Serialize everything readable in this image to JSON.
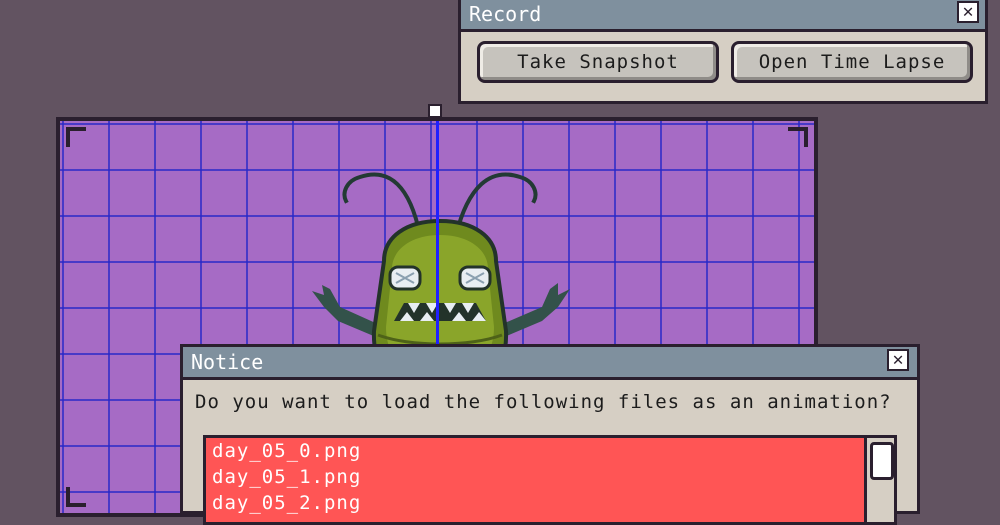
{
  "record_window": {
    "title": "Record",
    "close_glyph": "✕",
    "buttons": {
      "snapshot": "Take Snapshot",
      "time_lapse": "Open Time Lapse"
    }
  },
  "notice_window": {
    "title": "Notice",
    "close_glyph": "✕",
    "message": "Do you want to load the following files as an animation?",
    "files": [
      "day_05_0.png",
      "day_05_1.png",
      "day_05_2.png"
    ]
  },
  "colors": {
    "desktop": "#625361",
    "canvas": "#a66bc5",
    "grid": "#2828c8",
    "titlebar": "#7f909e",
    "window_body": "#d6cfc4",
    "list_highlight": "#ff5555"
  }
}
